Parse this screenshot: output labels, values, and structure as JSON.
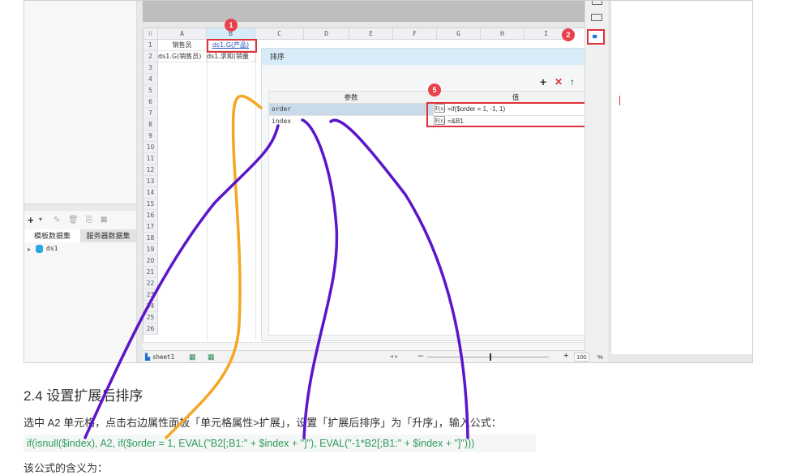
{
  "spreadsheet": {
    "columns": [
      "A",
      "B",
      "C",
      "D",
      "E",
      "F",
      "G",
      "H",
      "I"
    ],
    "rows": [
      "1",
      "2",
      "3",
      "4",
      "5",
      "6",
      "7",
      "8",
      "9",
      "10",
      "11",
      "12",
      "13",
      "14",
      "15",
      "16",
      "17",
      "18",
      "19",
      "20",
      "21",
      "22",
      "23",
      "24",
      "25",
      "26"
    ],
    "cells": {
      "a1": "销售员",
      "b1": "ds1.G(产品)",
      "a2": "ds1.G(销售员)",
      "b2": "ds1.求和(销量"
    },
    "sheet_tab": "sheet1",
    "zoom": "100",
    "zoom_unit": "%"
  },
  "left_panel": {
    "tabs": [
      "模板数据集",
      "服务器数据集"
    ],
    "tree_item": "ds1"
  },
  "sort_panel": {
    "title": "排序",
    "col_param": "参数",
    "col_value": "值",
    "fx": "F(x)",
    "params": [
      {
        "name": "order",
        "value": "=if($order = 1, -1, 1)"
      },
      {
        "name": "index",
        "value": "=&B1"
      }
    ],
    "toolbar": {
      "add": "+",
      "delete": "✕",
      "up": "↑",
      "down": "↓"
    }
  },
  "badges": [
    "1",
    "2",
    "5"
  ],
  "article": {
    "heading": "2.4 设置扩展后排序",
    "paragraph1": "选中 A2 单元格，点击右边属性面板「单元格属性>扩展」，设置「扩展后排序」为「升序」，输入公式：",
    "code": "if(isnull($index), A2, if($order = 1, EVAL(\"B2[;B1:\" + $index + \"]\"), EVAL(\"-1*B2[;B1:\" + $index + \"]\")))",
    "paragraph2": "该公式的含义为："
  },
  "colors": {
    "accent_red": "#e0303a",
    "annotation_orange": "#f5a623",
    "annotation_purple": "#5b16c9",
    "code_green": "#2e9a5b"
  }
}
